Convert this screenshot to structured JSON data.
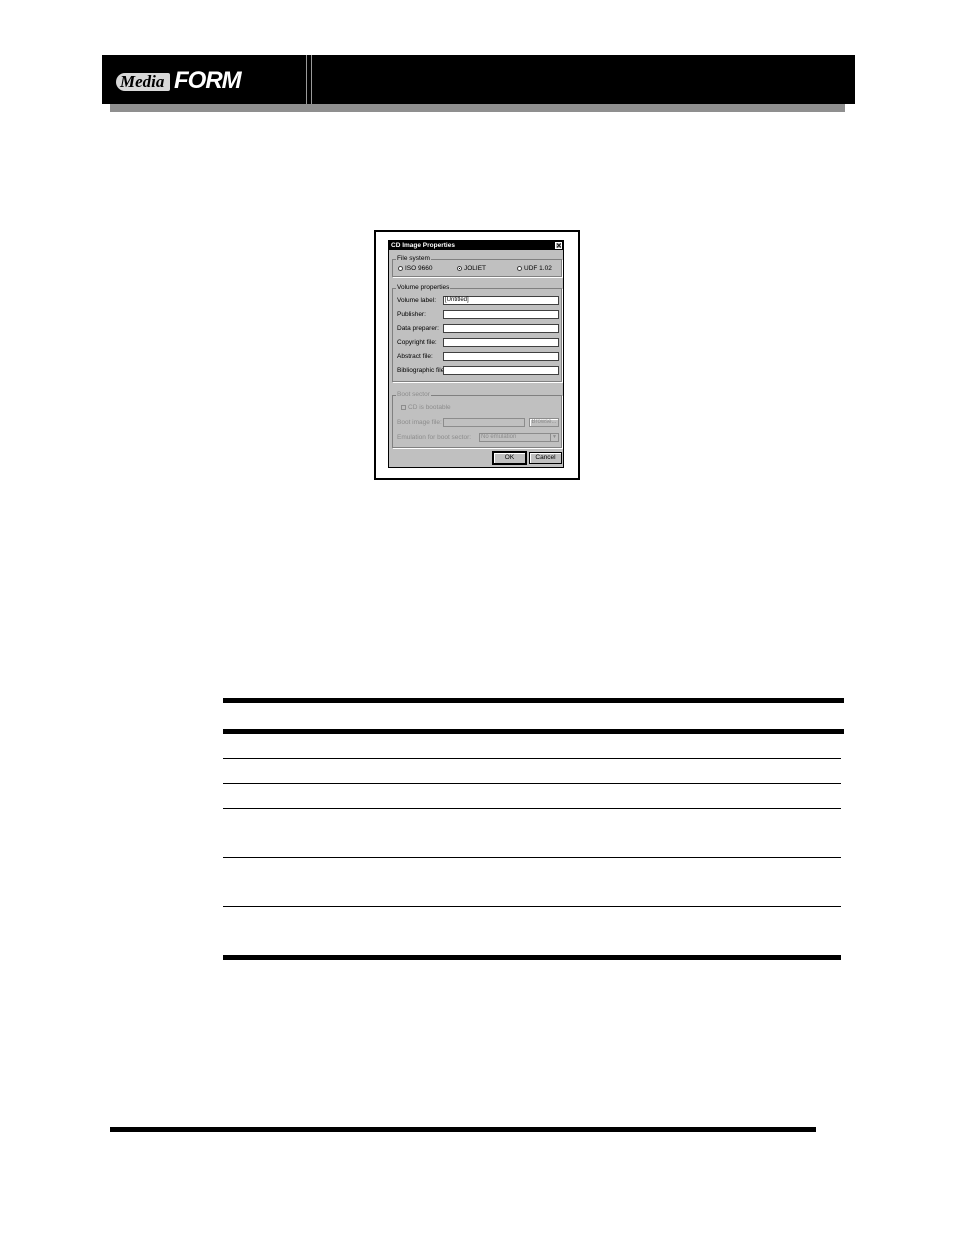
{
  "header": {
    "logo_text_media": "Media",
    "logo_text_form": "FORM"
  },
  "dialog": {
    "title": "CD Image Properties",
    "close_glyph": "✕",
    "file_system": {
      "group_label": "File system",
      "options": [
        {
          "label": "ISO 9660",
          "selected": false
        },
        {
          "label": "JOLIET",
          "selected": true
        },
        {
          "label": "UDF 1.02",
          "selected": false
        }
      ]
    },
    "volume": {
      "group_label": "Volume properties",
      "fields": [
        {
          "label": "Volume label:",
          "value": "[Untitled]"
        },
        {
          "label": "Publisher:",
          "value": ""
        },
        {
          "label": "Data preparer:",
          "value": ""
        },
        {
          "label": "Copyright file:",
          "value": ""
        },
        {
          "label": "Abstract file:",
          "value": ""
        },
        {
          "label": "Bibliographic file:",
          "value": ""
        }
      ]
    },
    "boot": {
      "group_label": "Boot sector",
      "checkbox_label": "CD is bootable",
      "image_label": "Boot image file:",
      "browse_label": "Browse...",
      "emulation_label": "Emulation for boot sector:",
      "emulation_value": "No emulation"
    },
    "ok_label": "OK",
    "cancel_label": "Cancel"
  }
}
